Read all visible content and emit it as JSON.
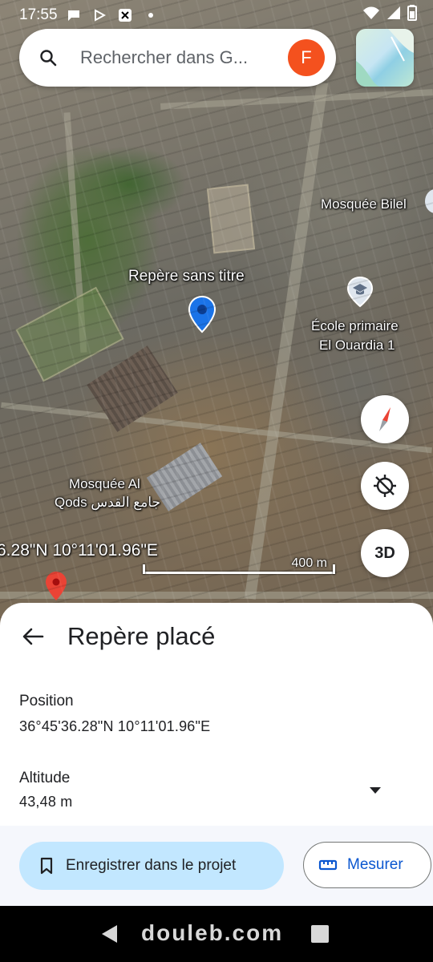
{
  "status_bar": {
    "time": "17:55",
    "icons": [
      "chat-bubble-icon",
      "play-icon",
      "app-icon",
      "dot-icon"
    ],
    "right_icons": [
      "wifi-icon",
      "signal-icon",
      "battery-icon"
    ]
  },
  "search": {
    "placeholder": "Rechercher dans G...",
    "avatar_letter": "F",
    "avatar_color": "#f4511e"
  },
  "map": {
    "labels": {
      "mosque_bilel": "Mosquée Bilel",
      "placemark": "Repère sans titre",
      "school_line1": "École primaire",
      "school_line2": "El Ouardia 1",
      "mosque_qods_line1": "Mosquée Al",
      "mosque_qods_line2": "Qods جامع القدس"
    },
    "coordinates_overlay": "6.28\"N 10°11'01.96\"E",
    "scale_label": "400 m",
    "button_3d": "3D"
  },
  "sheet": {
    "title": "Repère placé",
    "position_label": "Position",
    "position_value": "36°45'36.28\"N 10°11'01.96\"E",
    "altitude_label": "Altitude",
    "altitude_value": "43,48 m",
    "save_button": "Enregistrer dans le projet",
    "measure_button": "Mesurer"
  },
  "navbar": {
    "watermark": "douleb.com"
  },
  "colors": {
    "accent_blue": "#0b57d0",
    "primary_button_bg": "#c2e7ff",
    "pin_blue": "#1a73e8",
    "pin_red": "#ea4335"
  }
}
